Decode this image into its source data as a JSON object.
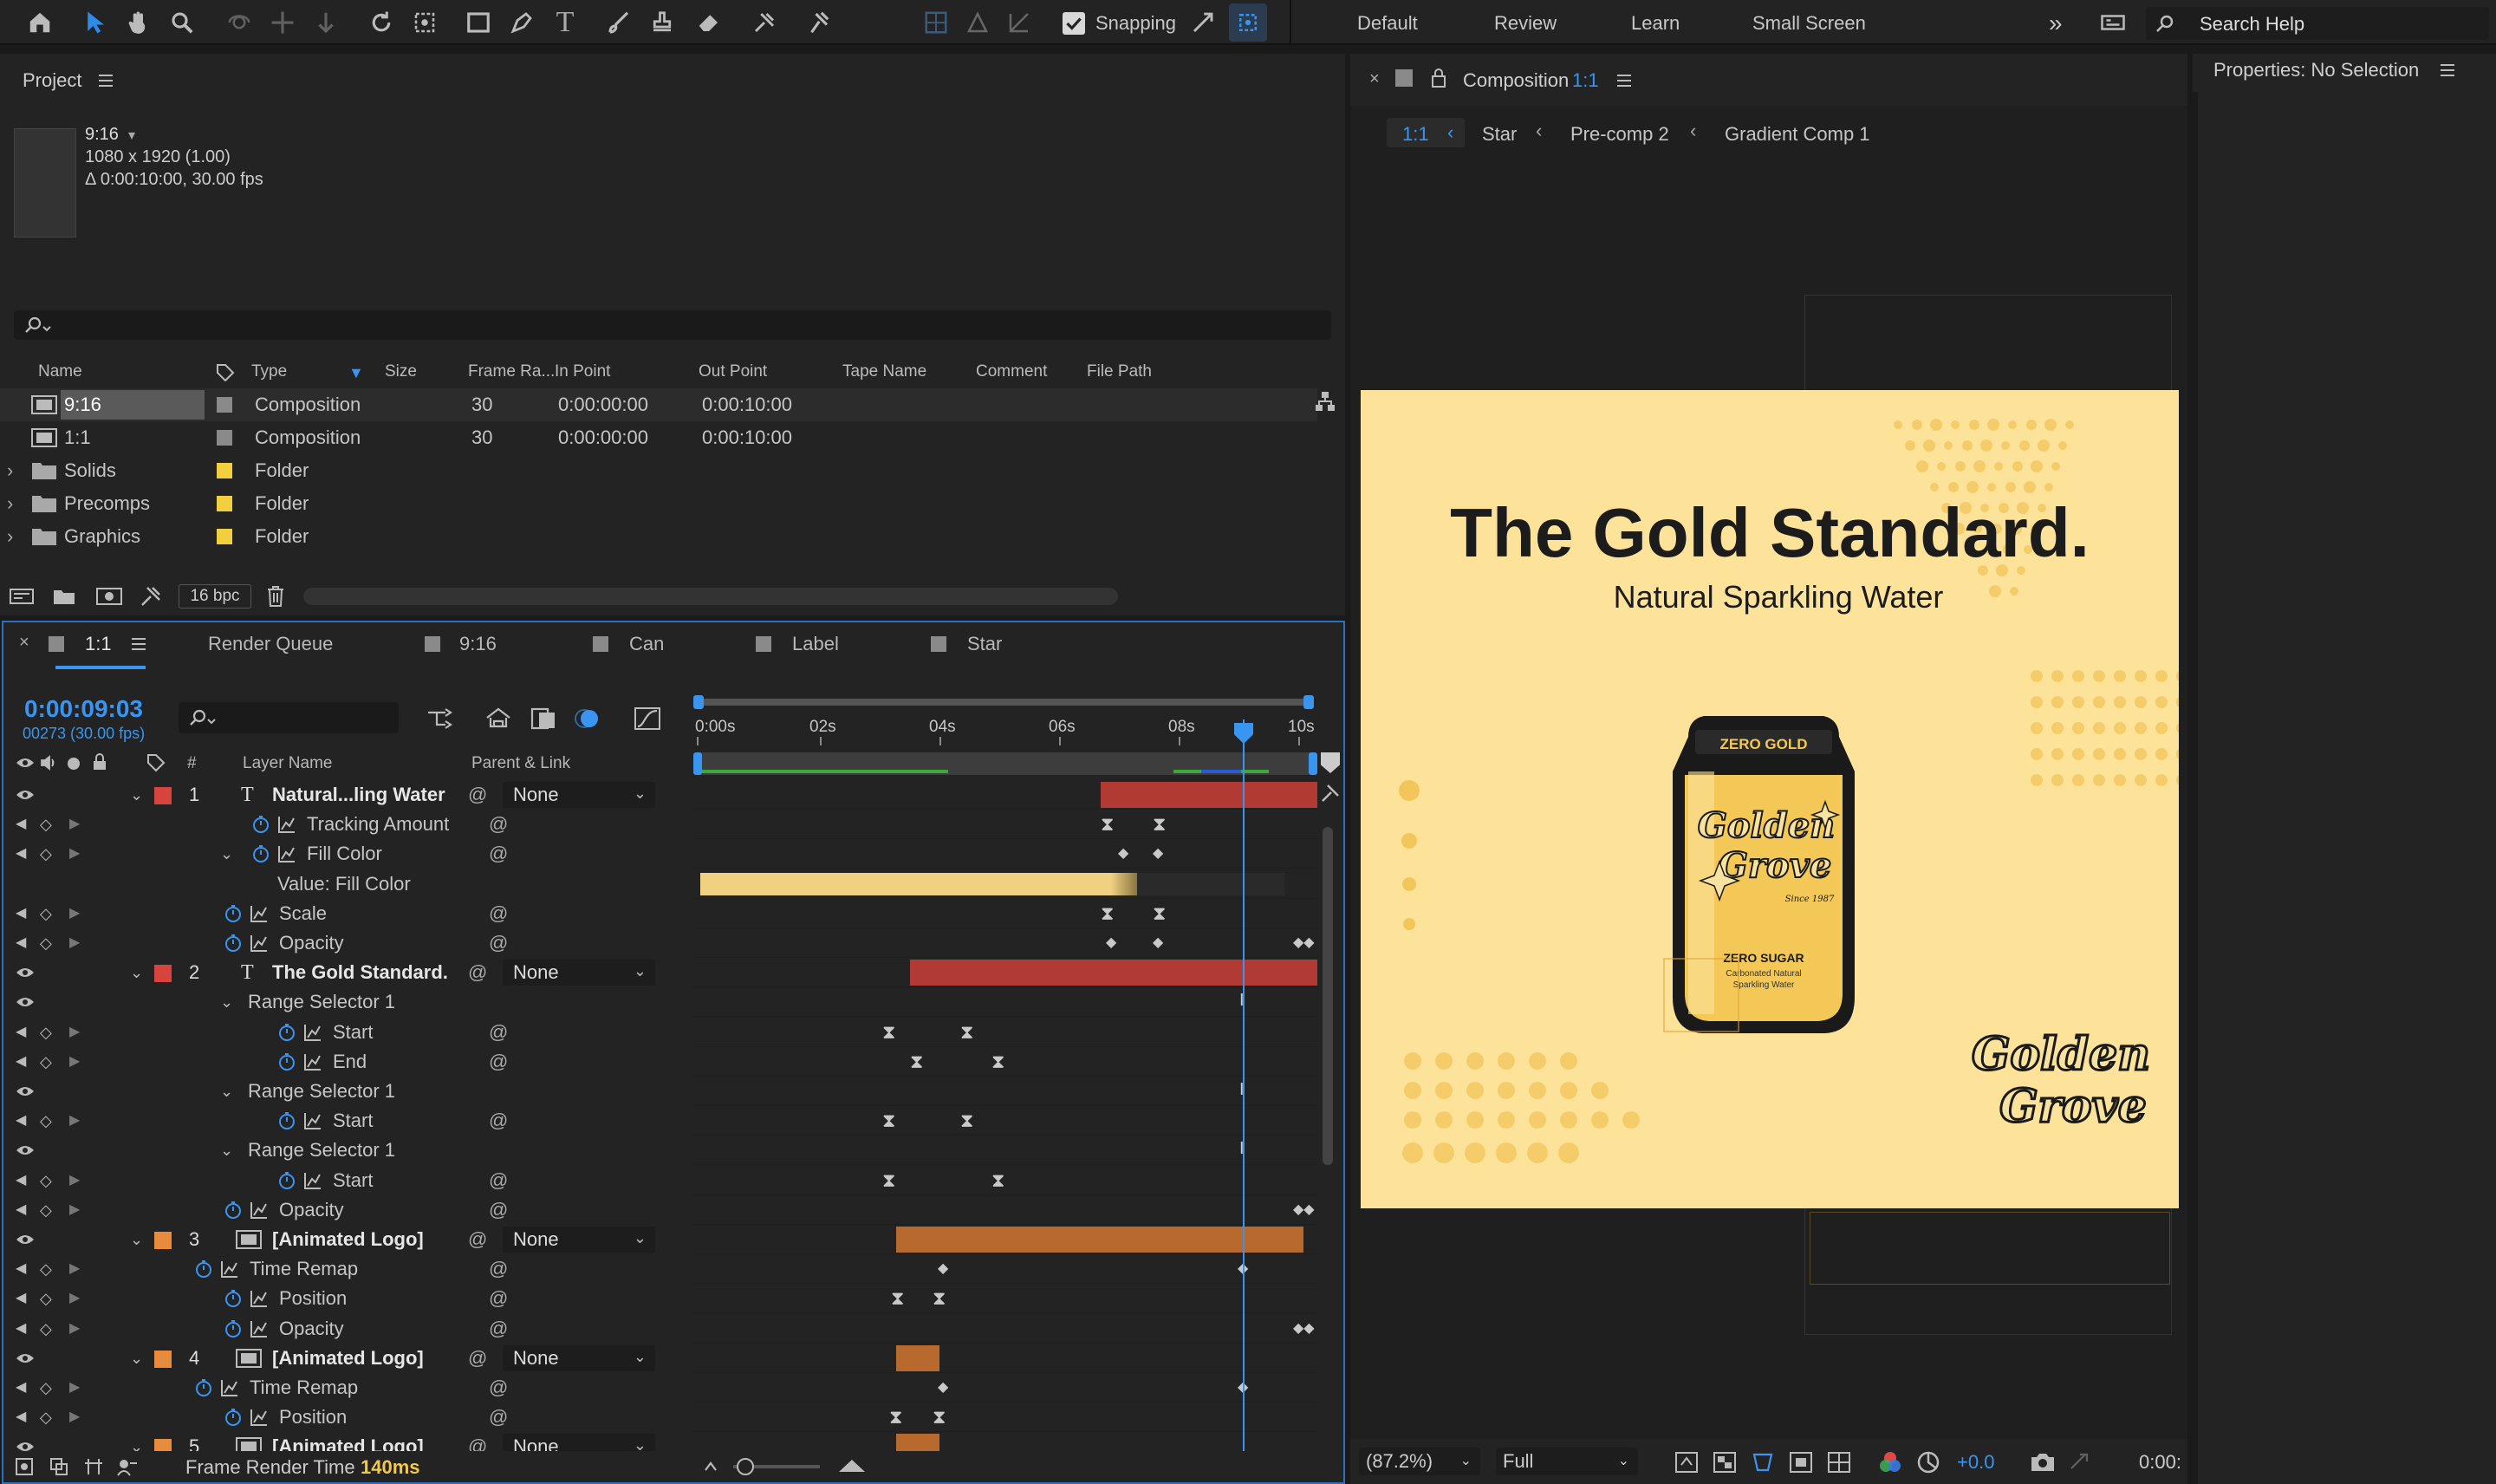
{
  "toolbar": {
    "snapping_label": "Snapping",
    "workspaces": [
      "Default",
      "Review",
      "Learn",
      "Small Screen"
    ],
    "search_placeholder": "Search Help"
  },
  "project": {
    "title": "Project",
    "thumb_name": "9:16",
    "thumb_dims": "1080 x 1920 (1.00)",
    "thumb_duration": "Δ 0:00:10:00, 30.00 fps",
    "columns": [
      "Name",
      "Type",
      "Size",
      "Frame Ra...",
      "In Point",
      "Out Point",
      "Tape Name",
      "Comment",
      "File Path"
    ],
    "items": [
      {
        "name": "9:16",
        "type": "Composition",
        "frame_rate": "30",
        "in": "0:00:00:00",
        "out": "0:00:10:00",
        "label_color": "#8a8a8a",
        "kind": "comp"
      },
      {
        "name": "1:1",
        "type": "Composition",
        "frame_rate": "30",
        "in": "0:00:00:00",
        "out": "0:00:10:00",
        "label_color": "#8a8a8a",
        "kind": "comp"
      },
      {
        "name": "Solids",
        "type": "Folder",
        "label_color": "#f2cf3f",
        "kind": "folder"
      },
      {
        "name": "Precomps",
        "type": "Folder",
        "label_color": "#f2cf3f",
        "kind": "folder"
      },
      {
        "name": "Graphics",
        "type": "Folder",
        "label_color": "#f2cf3f",
        "kind": "folder"
      }
    ],
    "bpc": "16 bpc"
  },
  "composition": {
    "title": "Composition",
    "name": "1:1",
    "breadcrumb": [
      "1:1",
      "Star",
      "Pre-comp 2",
      "Gradient Comp 1"
    ],
    "headline": "The Gold Standard.",
    "subhead": "Natural Sparkling Water",
    "can_top": "ZERO GOLD",
    "can_brand_1": "Golden",
    "can_brand_2": "Grove",
    "can_since": "Since 1987",
    "can_label": "ZERO SUGAR",
    "can_sub1": "Carbonated Natural",
    "can_sub2": "Sparkling Water",
    "logo_1": "Golden",
    "logo_2": "Grove",
    "zoom": "(87.2%)",
    "resolution": "Full",
    "exposure": "+0.0",
    "timecode": "0:00:",
    "bg_color": "#fde29a"
  },
  "properties": {
    "title": "Properties: No Selection"
  },
  "timeline": {
    "tabs": [
      "1:1",
      "Render Queue",
      "9:16",
      "Can",
      "Label",
      "Star"
    ],
    "timecode": "0:00:09:03",
    "frames": "00273 (30.00 fps)",
    "col_layer": "Layer Name",
    "col_parent": "Parent & Link",
    "col_num": "#",
    "ruler": [
      "0:00s",
      "02s",
      "04s",
      "06s",
      "08s",
      "10s"
    ],
    "render_time_label": "Frame Render Time",
    "render_time": "140ms",
    "rows": [
      {
        "type": "layer",
        "num": "1",
        "name": "Natural...ling Water",
        "parent": "None",
        "color": "#d8433d",
        "icon": "T"
      },
      {
        "type": "prop",
        "name": "Tracking Amount",
        "indent": 2
      },
      {
        "type": "prop",
        "name": "Fill Color",
        "indent": 2,
        "twirl": true
      },
      {
        "type": "value",
        "name": "Value: Fill Color"
      },
      {
        "type": "prop",
        "name": "Scale",
        "indent": 1
      },
      {
        "type": "prop",
        "name": "Opacity",
        "indent": 1
      },
      {
        "type": "layer",
        "num": "2",
        "name": "The Gold Standard.",
        "parent": "None",
        "color": "#d8433d",
        "icon": "T"
      },
      {
        "type": "group",
        "name": "Range Selector 1"
      },
      {
        "type": "prop",
        "name": "Start",
        "indent": 3
      },
      {
        "type": "prop",
        "name": "End",
        "indent": 3
      },
      {
        "type": "group",
        "name": "Range Selector 1"
      },
      {
        "type": "prop",
        "name": "Start",
        "indent": 3
      },
      {
        "type": "group",
        "name": "Range Selector 1"
      },
      {
        "type": "prop",
        "name": "Start",
        "indent": 3
      },
      {
        "type": "prop",
        "name": "Opacity",
        "indent": 1
      },
      {
        "type": "layer",
        "num": "3",
        "name": "[Animated Logo]",
        "parent": "None",
        "color": "#e88b3c",
        "icon": "comp"
      },
      {
        "type": "prop",
        "name": "Time Remap",
        "indent": 0
      },
      {
        "type": "prop",
        "name": "Position",
        "indent": 1
      },
      {
        "type": "prop",
        "name": "Opacity",
        "indent": 1
      },
      {
        "type": "layer",
        "num": "4",
        "name": "[Animated Logo]",
        "parent": "None",
        "color": "#e88b3c",
        "icon": "comp"
      },
      {
        "type": "prop",
        "name": "Time Remap",
        "indent": 0
      },
      {
        "type": "prop",
        "name": "Position",
        "indent": 1
      },
      {
        "type": "layer",
        "num": "5",
        "name": "[Animated Logo]",
        "parent": "None",
        "color": "#e88b3c",
        "icon": "comp"
      }
    ]
  }
}
